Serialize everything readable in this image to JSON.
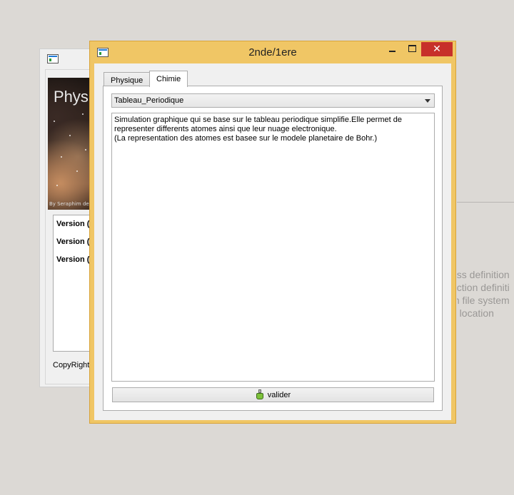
{
  "window": {
    "title": "2nde/1ere",
    "close_symbol": "✕"
  },
  "tabs": [
    {
      "label": "Physique",
      "active": false
    },
    {
      "label": "Chimie",
      "active": true
    }
  ],
  "combo": {
    "selected": "Tableau_Periodique"
  },
  "description": {
    "lines": [
      "Simulation graphique qui se base sur le tableau periodique simplifie.Elle permet de",
      "representer differents atomes ainsi que leur nuage electronique.",
      "(La representation des atomes est basee sur le modele planetaire de Bohr.)"
    ]
  },
  "valider_button": {
    "label": "valider",
    "icon": "flask-icon"
  },
  "back_window": {
    "poster_title": "Phys",
    "poster_credit": "By Seraphim de",
    "versions": [
      "Version (",
      "Version (",
      "Version ("
    ],
    "copyright": "CopyRight"
  },
  "background_app": {
    "lines": [
      "ass definition",
      "nction definiti",
      "m file system",
      "a location"
    ]
  },
  "colors": {
    "title_bar": "#f0c665",
    "close_button": "#c7302a",
    "desktop": "#dcd9d5"
  }
}
